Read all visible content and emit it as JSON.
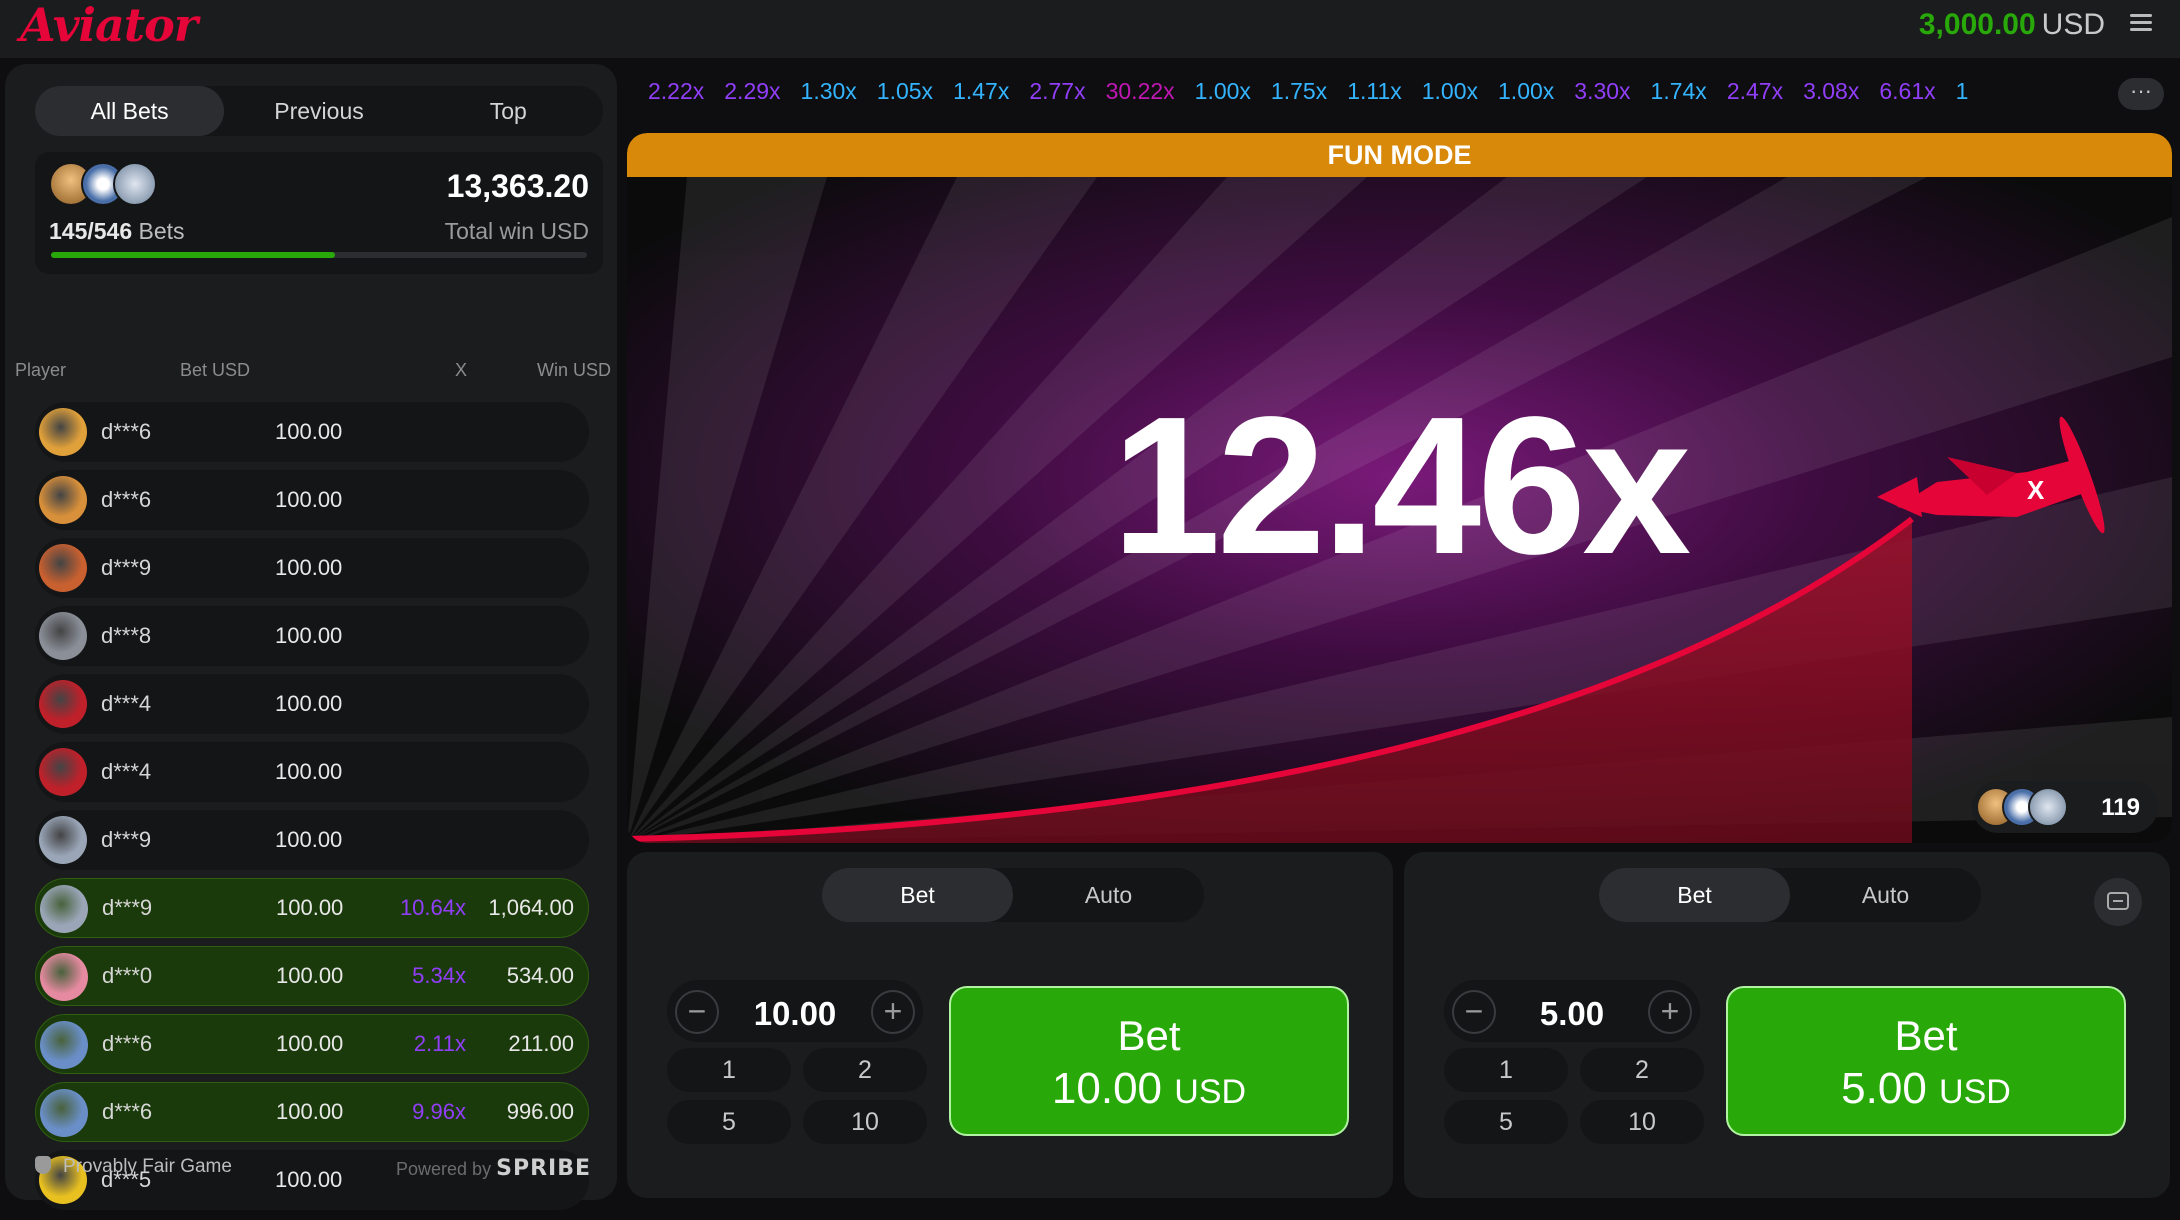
{
  "app": {
    "logo": "Aviator"
  },
  "header": {
    "balance": "3,000.00",
    "currency": "USD"
  },
  "bets_panel": {
    "tabs": [
      {
        "label": "All Bets",
        "active": true
      },
      {
        "label": "Previous",
        "active": false
      },
      {
        "label": "Top",
        "active": false
      }
    ],
    "summary": {
      "bets_count": "145/546",
      "bets_label": "Bets",
      "total_win": "13,363.20",
      "total_label": "Total win USD",
      "progress": 0.53
    },
    "columns": {
      "player": "Player",
      "bet": "Bet USD",
      "mult": "X",
      "win": "Win USD"
    },
    "rows": [
      {
        "name": "d***6",
        "bet": "100.00",
        "mult": "",
        "win": "",
        "avatar": "#e0a03a"
      },
      {
        "name": "d***6",
        "bet": "100.00",
        "mult": "",
        "win": "",
        "avatar": "#d9903a"
      },
      {
        "name": "d***9",
        "bet": "100.00",
        "mult": "",
        "win": "",
        "avatar": "#c86030"
      },
      {
        "name": "d***8",
        "bet": "100.00",
        "mult": "",
        "win": "",
        "avatar": "#8a8f98"
      },
      {
        "name": "d***4",
        "bet": "100.00",
        "mult": "",
        "win": "",
        "avatar": "#c0202a"
      },
      {
        "name": "d***4",
        "bet": "100.00",
        "mult": "",
        "win": "",
        "avatar": "#c0202a"
      },
      {
        "name": "d***9",
        "bet": "100.00",
        "mult": "",
        "win": "",
        "avatar": "#9aa6b8"
      },
      {
        "name": "d***9",
        "bet": "100.00",
        "mult": "10.64x",
        "win": "1,064.00",
        "avatar": "#9aa6b8"
      },
      {
        "name": "d***0",
        "bet": "100.00",
        "mult": "5.34x",
        "win": "534.00",
        "avatar": "#e58aa0"
      },
      {
        "name": "d***6",
        "bet": "100.00",
        "mult": "2.11x",
        "win": "211.00",
        "avatar": "#6a8fc8"
      },
      {
        "name": "d***6",
        "bet": "100.00",
        "mult": "9.96x",
        "win": "996.00",
        "avatar": "#6a8fc8"
      },
      {
        "name": "d***5",
        "bet": "100.00",
        "mult": "",
        "win": "",
        "avatar": "#e8c020"
      }
    ],
    "footer": {
      "fair": "Provably Fair Game",
      "powered": "Powered by",
      "brand": "SPRIBE"
    }
  },
  "history": [
    {
      "v": "2.22x",
      "c": "#913ef8"
    },
    {
      "v": "2.29x",
      "c": "#913ef8"
    },
    {
      "v": "1.30x",
      "c": "#34b4ff"
    },
    {
      "v": "1.05x",
      "c": "#34b4ff"
    },
    {
      "v": "1.47x",
      "c": "#34b4ff"
    },
    {
      "v": "2.77x",
      "c": "#913ef8"
    },
    {
      "v": "30.22x",
      "c": "#c017b4"
    },
    {
      "v": "1.00x",
      "c": "#34b4ff"
    },
    {
      "v": "1.75x",
      "c": "#34b4ff"
    },
    {
      "v": "1.11x",
      "c": "#34b4ff"
    },
    {
      "v": "1.00x",
      "c": "#34b4ff"
    },
    {
      "v": "1.00x",
      "c": "#34b4ff"
    },
    {
      "v": "3.30x",
      "c": "#913ef8"
    },
    {
      "v": "1.74x",
      "c": "#34b4ff"
    },
    {
      "v": "2.47x",
      "c": "#913ef8"
    },
    {
      "v": "3.08x",
      "c": "#913ef8"
    },
    {
      "v": "6.61x",
      "c": "#913ef8"
    },
    {
      "v": "1",
      "c": "#34b4ff"
    }
  ],
  "history_more": "···",
  "game": {
    "mode": "FUN MODE",
    "multiplier": "12.46x",
    "online_count": "119"
  },
  "bet_panels": [
    {
      "tabs": [
        "Bet",
        "Auto"
      ],
      "stake": "10.00",
      "quick": [
        "1",
        "2",
        "5",
        "10"
      ],
      "button_label": "Bet",
      "button_amount": "10.00",
      "button_currency": "USD"
    },
    {
      "tabs": [
        "Bet",
        "Auto"
      ],
      "stake": "5.00",
      "quick": [
        "1",
        "2",
        "5",
        "10"
      ],
      "button_label": "Bet",
      "button_amount": "5.00",
      "button_currency": "USD"
    }
  ],
  "colors": {
    "brand_red": "#e50539",
    "win_green": "#28a909",
    "fun_mode": "#d8890a"
  }
}
